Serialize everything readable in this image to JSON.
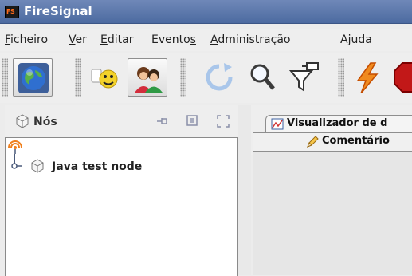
{
  "window": {
    "title": "FireSignal",
    "app_icon_text": "FS"
  },
  "menu": {
    "items": [
      {
        "label": "Ficheiro",
        "mnemonic": "F"
      },
      {
        "label": "Ver",
        "mnemonic": "V"
      },
      {
        "label": "Editar",
        "mnemonic": "E"
      },
      {
        "label": "Eventos",
        "mnemonic": "s"
      },
      {
        "label": "Administração",
        "mnemonic": "A"
      },
      {
        "label": "Ajuda",
        "mnemonic": ""
      }
    ]
  },
  "toolbar": {
    "buttons": [
      {
        "icon": "globe-icon",
        "pressed": true
      },
      {
        "icon": "smiley-chat-icon",
        "pressed": false
      },
      {
        "icon": "users-icon",
        "pressed": true
      },
      {
        "icon": "refresh-icon",
        "pressed": false
      },
      {
        "icon": "magnifier-icon",
        "pressed": false
      },
      {
        "icon": "filter-icon",
        "pressed": false
      },
      {
        "icon": "lightning-icon",
        "pressed": false
      },
      {
        "icon": "stop-icon",
        "pressed": false
      }
    ]
  },
  "nodes_panel": {
    "title": "Nós",
    "tree": [
      {
        "label": "Java test node"
      }
    ]
  },
  "right_panel": {
    "tabs": [
      {
        "label": "Visualizador de d"
      },
      {
        "label": "Comentário"
      }
    ]
  },
  "colors": {
    "titlebar": "#5a76aa",
    "accent": "#ff6a1a"
  }
}
